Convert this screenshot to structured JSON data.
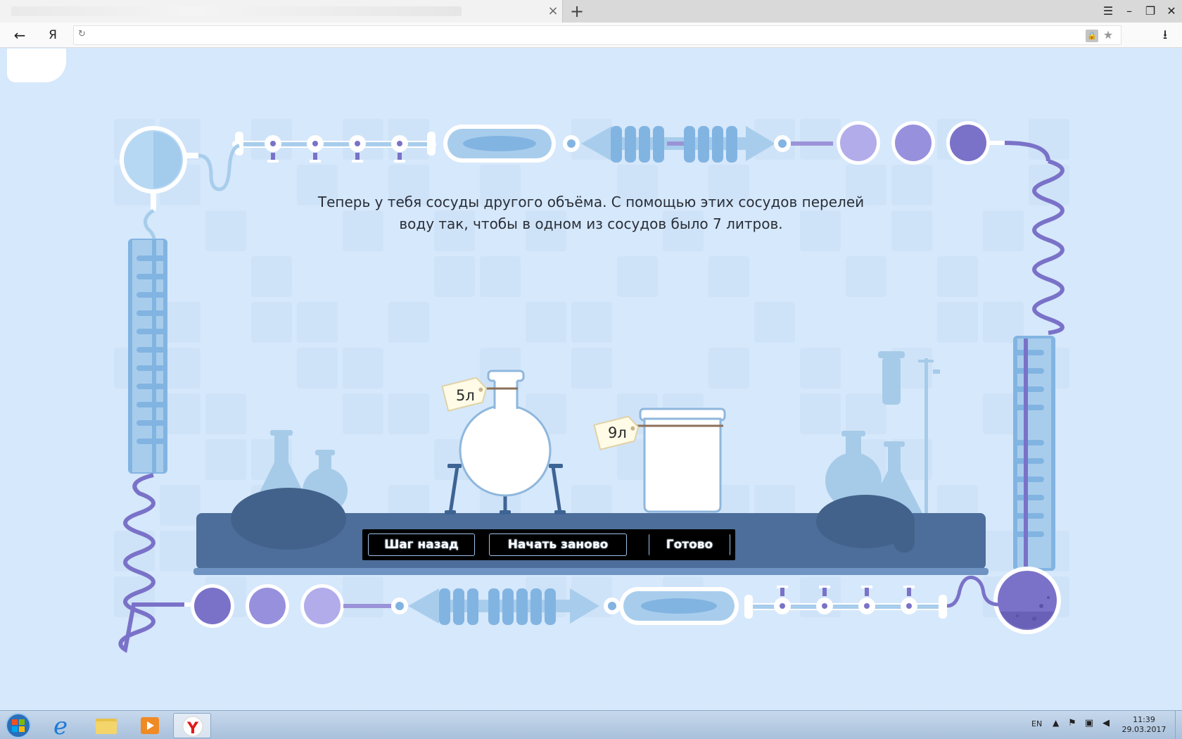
{
  "browser": {
    "tab_title": "",
    "new_tab_label": "+",
    "close_tab_label": "×",
    "window_controls": [
      "☰",
      "–",
      "❐",
      "✕"
    ],
    "back_label": "←",
    "ya_label": "Я",
    "address_value": "",
    "reload_label": "↻",
    "bookmark_label": "★",
    "download_label": "⭳"
  },
  "game": {
    "instruction": "Теперь у тебя сосуды другого объёма. С помощью этих сосудов перелей воду так, чтобы в одном из сосудов было 7 литров.",
    "vessels": [
      {
        "label": "5л",
        "shape": "round-flask",
        "capacity": 5,
        "fill_fraction": 0
      },
      {
        "label": "9л",
        "shape": "beaker",
        "capacity": 9,
        "fill_fraction": 0
      }
    ],
    "buttons": {
      "step_back": "Шаг назад",
      "restart": "Начать заново",
      "done": "Готово"
    },
    "colors": {
      "background": "#d6e8fb",
      "tube_light": "#a8cdec",
      "tube_mid": "#82b4e2",
      "accent_purple": "#7a72c8",
      "table": "#4d6e9a"
    }
  },
  "taskbar": {
    "pinned": [
      "windows-start",
      "internet-explorer",
      "file-explorer",
      "media-player",
      "yandex-browser"
    ],
    "language": "EN",
    "time": "11:39",
    "date": "29.03.2017"
  }
}
